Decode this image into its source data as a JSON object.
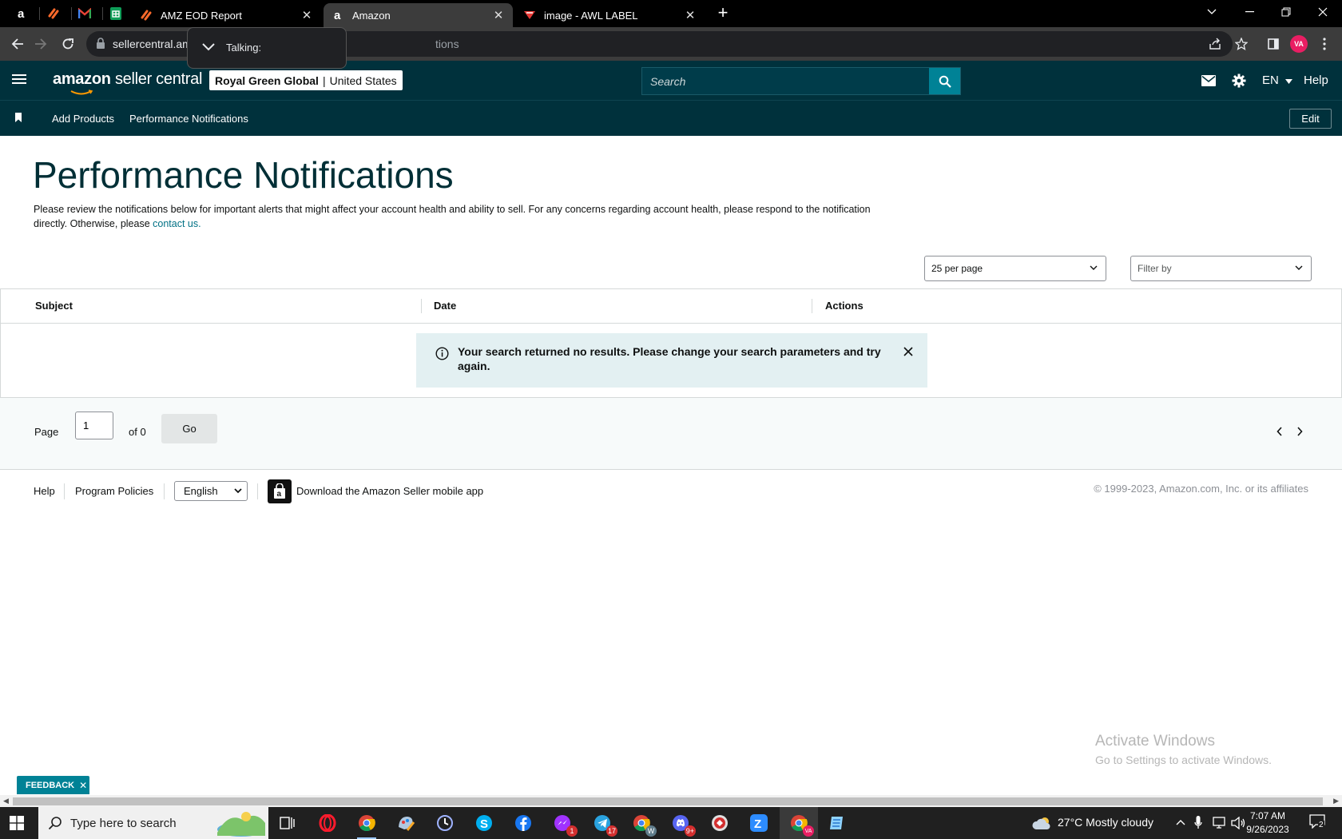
{
  "browser": {
    "tabs": [
      {
        "title": "AMZ EOD Report",
        "icon": "zapier-icon"
      },
      {
        "title": "Amazon",
        "icon": "amazon-icon",
        "active": true
      },
      {
        "title": "image - AWL LABEL",
        "icon": "label-icon"
      }
    ],
    "url_start": "sellercentral.am",
    "url_end": "tions",
    "profile_initials": "VA",
    "talking_label": "Talking:"
  },
  "header": {
    "logo_brand": "amazon",
    "logo_text": "seller central",
    "account_name": "Royal Green Global",
    "account_separator": "|",
    "marketplace": "United States",
    "search_placeholder": "Search",
    "language": "EN",
    "help": "Help"
  },
  "nav": {
    "items": [
      "Add Products",
      "Performance Notifications"
    ],
    "edit": "Edit"
  },
  "page": {
    "title": "Performance Notifications",
    "description": "Please review the notifications below for important alerts that might affect your account health and ability to sell. For any concerns regarding account health, please respond to the notification directly. Otherwise, please ",
    "contact_link": "contact us.",
    "per_page": "25 per page",
    "filter_placeholder": "Filter by"
  },
  "table": {
    "columns": [
      "Subject",
      "Date",
      "Actions"
    ],
    "empty_message": "Your search returned no results. Please change your search parameters and try again."
  },
  "pagination": {
    "page_label": "Page",
    "current_page": "1",
    "of_label": "of 0",
    "go_label": "Go"
  },
  "footer": {
    "help": "Help",
    "program_policies": "Program Policies",
    "language": "English",
    "download_app": "Download the Amazon Seller mobile app",
    "copyright": "© 1999-2023, Amazon.com, Inc. or its affiliates"
  },
  "feedback": "FEEDBACK",
  "watermark": {
    "line1": "Activate Windows",
    "line2": "Go to Settings to activate Windows."
  },
  "taskbar": {
    "search_placeholder": "Type here to search",
    "weather": "27°C  Mostly cloudy",
    "time": "7:07 AM",
    "date": "9/26/2023",
    "notifications_count": "2",
    "badges": {
      "messenger": "1",
      "telegram": "17",
      "discord": "9+",
      "chrome_w": "W"
    }
  },
  "colors": {
    "header_bg": "#00313c",
    "accent": "#008296",
    "link": "#007185",
    "alert_bg": "#e3f0f2"
  }
}
